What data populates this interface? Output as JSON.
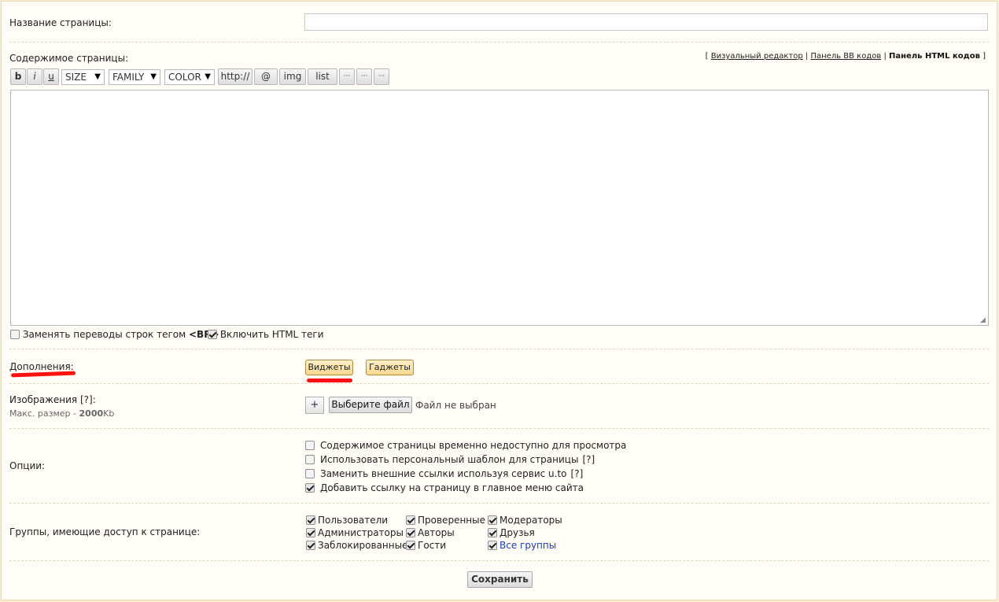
{
  "form": {
    "title_label": "Название страницы:",
    "content_label": "Содержимое страницы:",
    "editor_links": {
      "visual": "Визуальный редактор",
      "bb": "Панель BB кодов",
      "html": "Панель HTML кодов",
      "sep": "|",
      "open": "[",
      "close": "]"
    },
    "toolbar": {
      "bold": "b",
      "italic": "i",
      "underline": "u",
      "size": "SIZE",
      "family": "FAMILY",
      "color": "COLOR",
      "http": "http://",
      "at": "@",
      "img": "img",
      "list": "list",
      "more1": "···",
      "more2": "···",
      "more3": "···"
    },
    "replace_br_label": "Заменять переводы строк тегом",
    "replace_br_tag": "<BR>",
    "replace_br_checked": false,
    "html_tags_label": "Включить HTML теги",
    "html_tags_checked": true,
    "addons_label": "Дополнения:",
    "widgets_button": "Виджеты",
    "gadgets_button": "Гаджеты",
    "images_label": "Изображения",
    "images_help": "[?]",
    "images_colon": ":",
    "max_size_label": "Макс. размер -",
    "max_size_value": "2000",
    "max_size_unit": "Kb",
    "plus_button": "+",
    "file_button": "Выберите файл",
    "file_status": "Файл не выбран",
    "options_label": "Опции:",
    "options": [
      {
        "label": "Содержимое страницы временно недоступно для просмотра",
        "help": "",
        "checked": false
      },
      {
        "label": "Использовать персональный шаблон для страницы",
        "help": "[?]",
        "checked": false
      },
      {
        "label": "Заменить внешние ссылки используя сервис u.to",
        "help": "[?]",
        "checked": false
      },
      {
        "label": "Добавить ссылку на страницу в главное меню сайта",
        "help": "",
        "checked": true
      }
    ],
    "groups_label": "Группы, имеющие доступ к странице:",
    "groups": [
      {
        "label": "Пользователи",
        "checked": true
      },
      {
        "label": "Проверенные",
        "checked": true
      },
      {
        "label": "Модераторы",
        "checked": true
      },
      {
        "label": "Администраторы",
        "checked": true
      },
      {
        "label": "Авторы",
        "checked": true
      },
      {
        "label": "Друзья",
        "checked": true
      },
      {
        "label": "Заблокированные",
        "checked": true
      },
      {
        "label": "Гости",
        "checked": true
      },
      {
        "label": "Все группы",
        "checked": true
      }
    ],
    "save_button": "Сохранить"
  },
  "colors": {
    "annotation_red": "#ff1010",
    "all_groups_link": "#1a3fc4",
    "panel_background": "#fffdf6"
  }
}
